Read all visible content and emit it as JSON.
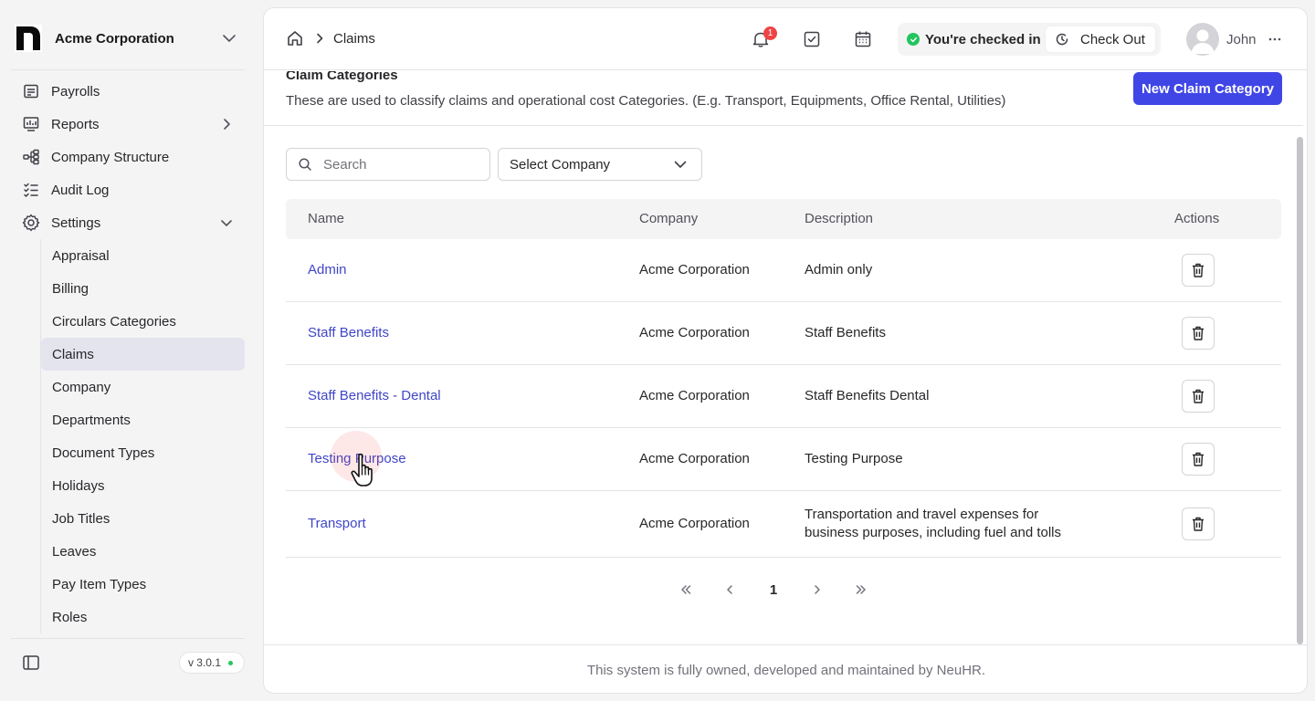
{
  "org": {
    "name": "Acme Corporation",
    "logo_icon": "brand-n-logo"
  },
  "sidebar": {
    "items": [
      {
        "label": "Payrolls",
        "icon": "receipt-icon"
      },
      {
        "label": "Reports",
        "icon": "chart-icon"
      },
      {
        "label": "Company Structure",
        "icon": "hierarchy-icon"
      },
      {
        "label": "Audit Log",
        "icon": "list-check-icon"
      },
      {
        "label": "Settings",
        "icon": "gear-icon"
      }
    ],
    "settings_items": [
      "Appraisal",
      "Billing",
      "Circulars Categories",
      "Claims",
      "Company",
      "Departments",
      "Document Types",
      "Holidays",
      "Job Titles",
      "Leaves",
      "Pay Item Types",
      "Roles"
    ],
    "active_item": "Claims",
    "version": "v 3.0.1"
  },
  "header": {
    "breadcrumb": {
      "current": "Claims"
    },
    "notification_count": "1",
    "check_status": "You're checked in",
    "check_out_label": "Check Out",
    "user_name": "John"
  },
  "page": {
    "title": "Claim Categories",
    "description": "These are used to classify claims and operational cost Categories. (E.g. Transport, Equipments, Office Rental, Utilities)",
    "new_button_label": "New Claim Category"
  },
  "filters": {
    "search_placeholder": "Search",
    "company_select": "Select Company"
  },
  "table": {
    "columns": [
      "Name",
      "Company",
      "Description",
      "Actions"
    ],
    "rows": [
      {
        "name": "Admin",
        "company": "Acme Corporation",
        "description": "Admin only"
      },
      {
        "name": "Staff Benefits",
        "company": "Acme Corporation",
        "description": "Staff Benefits"
      },
      {
        "name": "Staff Benefits - Dental",
        "company": "Acme Corporation",
        "description": "Staff Benefits Dental"
      },
      {
        "name": "Testing Purpose",
        "company": "Acme Corporation",
        "description": "Testing Purpose"
      },
      {
        "name": "Transport",
        "company": "Acme Corporation",
        "description": "Transportation and travel expenses for business purposes, including fuel and tolls"
      }
    ]
  },
  "pagination": {
    "current_page": "1"
  },
  "footer": {
    "text": "This system is fully owned, developed and maintained by NeuHR."
  },
  "colors": {
    "primary": "#4046e6",
    "link": "#4046c8",
    "success": "#22c55e",
    "badge": "#ef4444"
  }
}
